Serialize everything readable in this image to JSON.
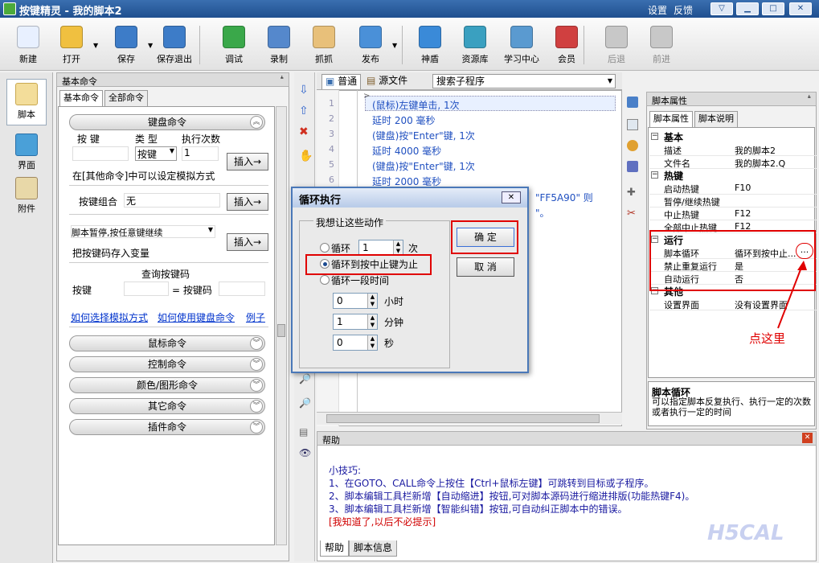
{
  "window": {
    "title": "按键精灵 - 我的脚本2",
    "settings": "设置",
    "feedback": "反馈"
  },
  "toolbar": [
    {
      "label": "新建",
      "icon": "new-document-icon",
      "color": "#e8f0ff"
    },
    {
      "label": "打开",
      "icon": "open-folder-icon",
      "color": "#f0c040"
    },
    {
      "label": "保存",
      "icon": "save-disk-icon",
      "color": "#3d7cc8"
    },
    {
      "label": "保存退出",
      "icon": "save-exit-icon",
      "color": "#3d7cc8"
    },
    {
      "label": "调试",
      "icon": "debug-icon",
      "color": "#3aa84a"
    },
    {
      "label": "录制",
      "icon": "record-camera-icon",
      "color": "#5588cc"
    },
    {
      "label": "抓抓",
      "icon": "grab-hand-icon",
      "color": "#e8c07a"
    },
    {
      "label": "发布",
      "icon": "publish-globe-icon",
      "color": "#4a90d8"
    },
    {
      "label": "神盾",
      "icon": "shield-icon",
      "color": "#3a8ad8"
    },
    {
      "label": "资源库",
      "icon": "resource-library-icon",
      "color": "#3aa0c0"
    },
    {
      "label": "学习中心",
      "icon": "learning-center-icon",
      "color": "#5a9ad0"
    },
    {
      "label": "会员",
      "icon": "member-icon",
      "color": "#d04040"
    },
    {
      "label": "后退",
      "icon": "back-arrow-icon",
      "color": "#c8c8c8"
    },
    {
      "label": "前进",
      "icon": "forward-arrow-icon",
      "color": "#c8c8c8"
    }
  ],
  "sidebar": {
    "items": [
      {
        "label": "脚本",
        "icon": "script-icon"
      },
      {
        "label": "界面",
        "icon": "interface-icon"
      },
      {
        "label": "附件",
        "icon": "attachment-icon"
      }
    ]
  },
  "left_panel": {
    "title": "基本命令",
    "pin": "ᗮ",
    "tabs": [
      "基本命令",
      "全部命令"
    ],
    "keyboard_group": "键盘命令",
    "key_label": "按 键",
    "type_label": "类 型",
    "count_label": "执行次数",
    "type_value": "按键",
    "count_value": "1",
    "insert": "插入→",
    "note": "在[其他命令]中可以设定模拟方式",
    "combo_label": "按键组合",
    "combo_value": "无",
    "pause_select": "脚本暂停,按任意键继续",
    "store_label": "把按键码存入变量",
    "query_title": "查询按键码",
    "query_key": "按键",
    "query_code": "= 按键码",
    "links": [
      "如何选择模拟方式",
      "如何使用键盘命令",
      "例子"
    ],
    "groups": [
      "鼠标命令",
      "控制命令",
      "颜色/图形命令",
      "其它命令",
      "插件命令"
    ]
  },
  "editor": {
    "tab_normal": "普通",
    "tab_source": "源文件",
    "search": "搜索子程序",
    "lines": [
      {
        "n": "1",
        "t": "(鼠标)左键单击, 1次"
      },
      {
        "n": "2",
        "t": "延时 200 毫秒"
      },
      {
        "n": "3",
        "t": "(键盘)按\"Enter\"键, 1次"
      },
      {
        "n": "4",
        "t": "延时 4000 毫秒"
      },
      {
        "n": "5",
        "t": "(键盘)按\"Enter\"键, 1次"
      },
      {
        "n": "6",
        "t": "延时 2000 毫秒"
      }
    ],
    "line7_tail": "\"FF5A90\" 则",
    "line8_tail": "\"。"
  },
  "dialog": {
    "title": "循环执行",
    "prompt": "我想让这些动作",
    "loop_label": "循环",
    "loop_count": "1",
    "times": "次",
    "until_stop": "循环到按中止键为止",
    "period": "循环一段时间",
    "hour_val": "0",
    "hour": "小时",
    "minute_val": "1",
    "minute": "分钟",
    "second_val": "0",
    "second": "秒",
    "ok": "确 定",
    "cancel": "取 消"
  },
  "props": {
    "title": "脚本属性",
    "tabs": [
      "脚本属性",
      "脚本说明"
    ],
    "cats": [
      {
        "name": "基本",
        "rows": [
          {
            "k": "描述",
            "v": "我的脚本2"
          },
          {
            "k": "文件名",
            "v": "我的脚本2.Q"
          }
        ]
      },
      {
        "name": "热键",
        "rows": [
          {
            "k": "启动热键",
            "v": "F10"
          },
          {
            "k": "暂停/继续热键",
            "v": ""
          },
          {
            "k": "中止热键",
            "v": "F12"
          },
          {
            "k": "全部中止热键",
            "v": "F12"
          }
        ]
      },
      {
        "name": "运行",
        "rows": [
          {
            "k": "脚本循环",
            "v": "循环到按中止..."
          },
          {
            "k": "禁止重复运行",
            "v": "是"
          },
          {
            "k": "自动运行",
            "v": "否"
          }
        ]
      },
      {
        "name": "其他",
        "rows": [
          {
            "k": "设置界面",
            "v": "没有设置界面"
          }
        ]
      }
    ],
    "more": "...",
    "annotation": "点这里",
    "desc_title": "脚本循环",
    "desc_text": "可以指定脚本反复执行、执行一定的次数或者执行一定的时间"
  },
  "help": {
    "title": "帮助",
    "lines": [
      "小技巧:",
      "1、在GOTO、CALL命令上按住【Ctrl+鼠标左键】可跳转到目标或子程序。",
      "2、脚本编辑工具栏新增【自动缩进】按钮,可对脚本源码进行缩进排版(功能热键F4)。",
      "3、脚本编辑工具栏新增【智能纠错】按钮,可自动纠正脚本中的错误。"
    ],
    "dismiss": "[我知道了,以后不必提示]",
    "tabs": [
      "帮助",
      "脚本信息"
    ]
  }
}
